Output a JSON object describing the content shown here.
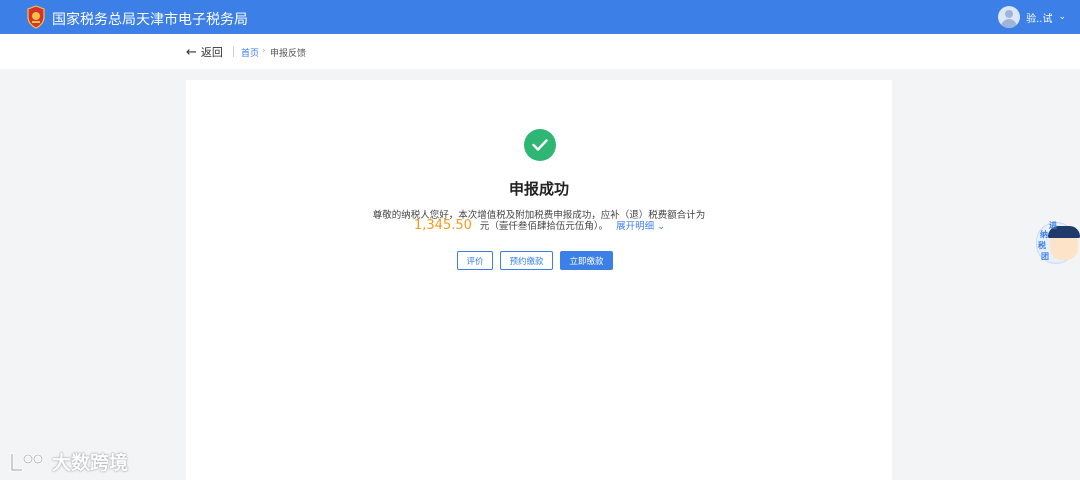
{
  "header": {
    "site_title": "国家税务总局天津市电子税务局",
    "user_name": "验..试",
    "user_menu_icon": "chevron-down-icon",
    "colors": {
      "bar": "#3c7fe6"
    }
  },
  "breadcrumb": {
    "back_label": "返回",
    "home": "首页",
    "separator": "›",
    "current": "申报反馈"
  },
  "result": {
    "status_icon": "check-circle-icon",
    "title": "申报成功",
    "description": "尊敬的纳税人您好，本次增值税及附加税费申报成功，应补（退）税费额合计为",
    "amount": "1,345.50",
    "amount_unit": "元",
    "amount_words": "（壹仟叁佰肆拾伍元伍角）。",
    "expand_label": "展开明细",
    "colors": {
      "success": "#2fb574",
      "amount": "#f39b1c"
    }
  },
  "actions": {
    "evaluate": "评价",
    "schedule_payment": "预约缴款",
    "pay_now": "立即缴款"
  },
  "assistant": {
    "label_chars": [
      "进",
      "纳",
      "税",
      "团"
    ]
  },
  "watermark": {
    "text": "大数跨境"
  }
}
